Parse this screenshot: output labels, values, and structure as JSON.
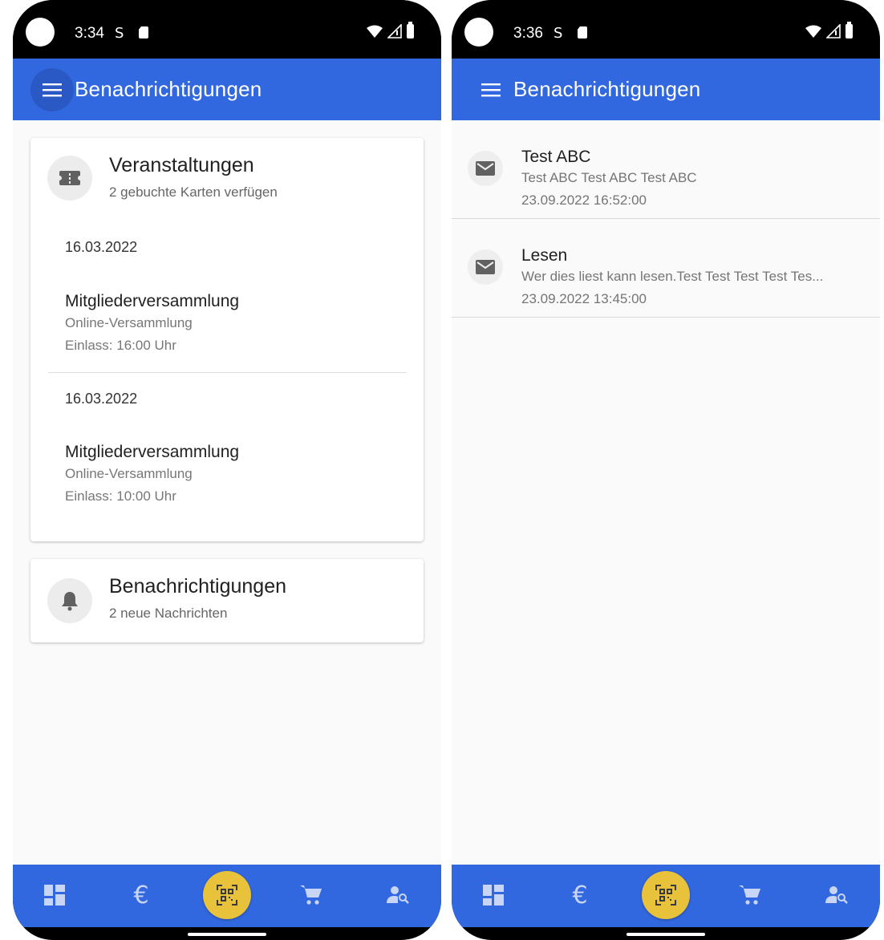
{
  "left_screen": {
    "status": {
      "time": "3:34"
    },
    "appbar": {
      "title": "Benachrichtigungen"
    },
    "events_card": {
      "title": "Veranstaltungen",
      "subtitle": "2 gebuchte Karten verfügen",
      "events": [
        {
          "date": "16.03.2022",
          "title": "Mitgliederversammlung",
          "location": "Online-Versammlung",
          "entry": "Einlass: 16:00 Uhr"
        },
        {
          "date": "16.03.2022",
          "title": "Mitgliederversammlung",
          "location": "Online-Versammlung",
          "entry": "Einlass: 10:00 Uhr"
        }
      ]
    },
    "notifications_card": {
      "title": "Benachrichtigungen",
      "subtitle": "2 neue Nachrichten"
    }
  },
  "right_screen": {
    "status": {
      "time": "3:36"
    },
    "appbar": {
      "title": "Benachrichtigungen"
    },
    "messages": [
      {
        "title": "Test ABC",
        "body": "Test ABC Test ABC Test ABC",
        "date": "23.09.2022 16:52:00"
      },
      {
        "title": "Lesen",
        "body": "Wer dies liest kann lesen.Test Test Test Test Tes...",
        "date": "23.09.2022 13:45:00"
      }
    ]
  },
  "bottom_nav": {
    "items": [
      {
        "icon": "dashboard-icon"
      },
      {
        "icon": "euro-icon"
      },
      {
        "icon": "qr-scan-icon"
      },
      {
        "icon": "cart-icon"
      },
      {
        "icon": "person-search-icon"
      }
    ]
  },
  "colors": {
    "primary": "#3268df",
    "fab": "#e8c23a",
    "background": "#fafafa"
  }
}
